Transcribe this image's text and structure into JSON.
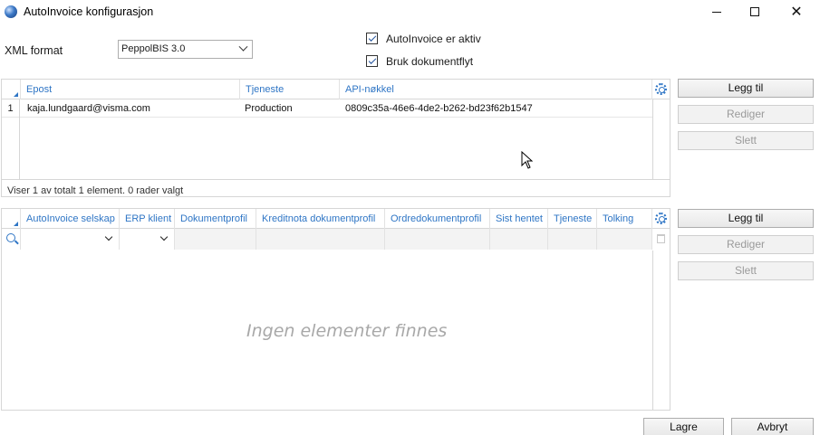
{
  "window": {
    "title": "AutoInvoice konfigurasjon",
    "min_icon": "minimize-icon",
    "max_icon": "maximize-icon",
    "close_symbol": "✕"
  },
  "settings": {
    "xml_format_label": "XML format",
    "xml_format_value": "PeppolBIS 3.0",
    "checkbox_active_label": "AutoInvoice er aktiv",
    "checkbox_active_checked": true,
    "checkbox_flow_label": "Bruk dokumentflyt",
    "checkbox_flow_checked": true
  },
  "top_grid": {
    "columns": [
      "Epost",
      "Tjeneste",
      "API-nøkkel"
    ],
    "rows": [
      {
        "num": "1",
        "epost": "kaja.lundgaard@visma.com",
        "tjeneste": "Production",
        "api_key": "0809c35a-46e6-4de2-b262-bd23f62b1547"
      }
    ],
    "status": "Viser 1 av totalt 1 element. 0 rader valgt"
  },
  "top_buttons": {
    "add": "Legg til",
    "edit": "Rediger",
    "delete": "Slett"
  },
  "bottom_grid": {
    "columns": [
      "AutoInvoice selskap",
      "ERP klient",
      "Dokumentprofil",
      "Kreditnota dokumentprofil",
      "Ordredokumentprofil",
      "Sist hentet",
      "Tjeneste",
      "Tolking"
    ],
    "empty_text": "Ingen elementer finnes"
  },
  "bottom_buttons": {
    "add": "Legg til",
    "edit": "Rediger",
    "delete": "Slett"
  },
  "footer": {
    "save": "Lagre",
    "cancel": "Avbryt"
  },
  "colors": {
    "accent": "#2e75c5",
    "border": "#d6d6d6",
    "disabled_text": "#9a9a9a"
  }
}
